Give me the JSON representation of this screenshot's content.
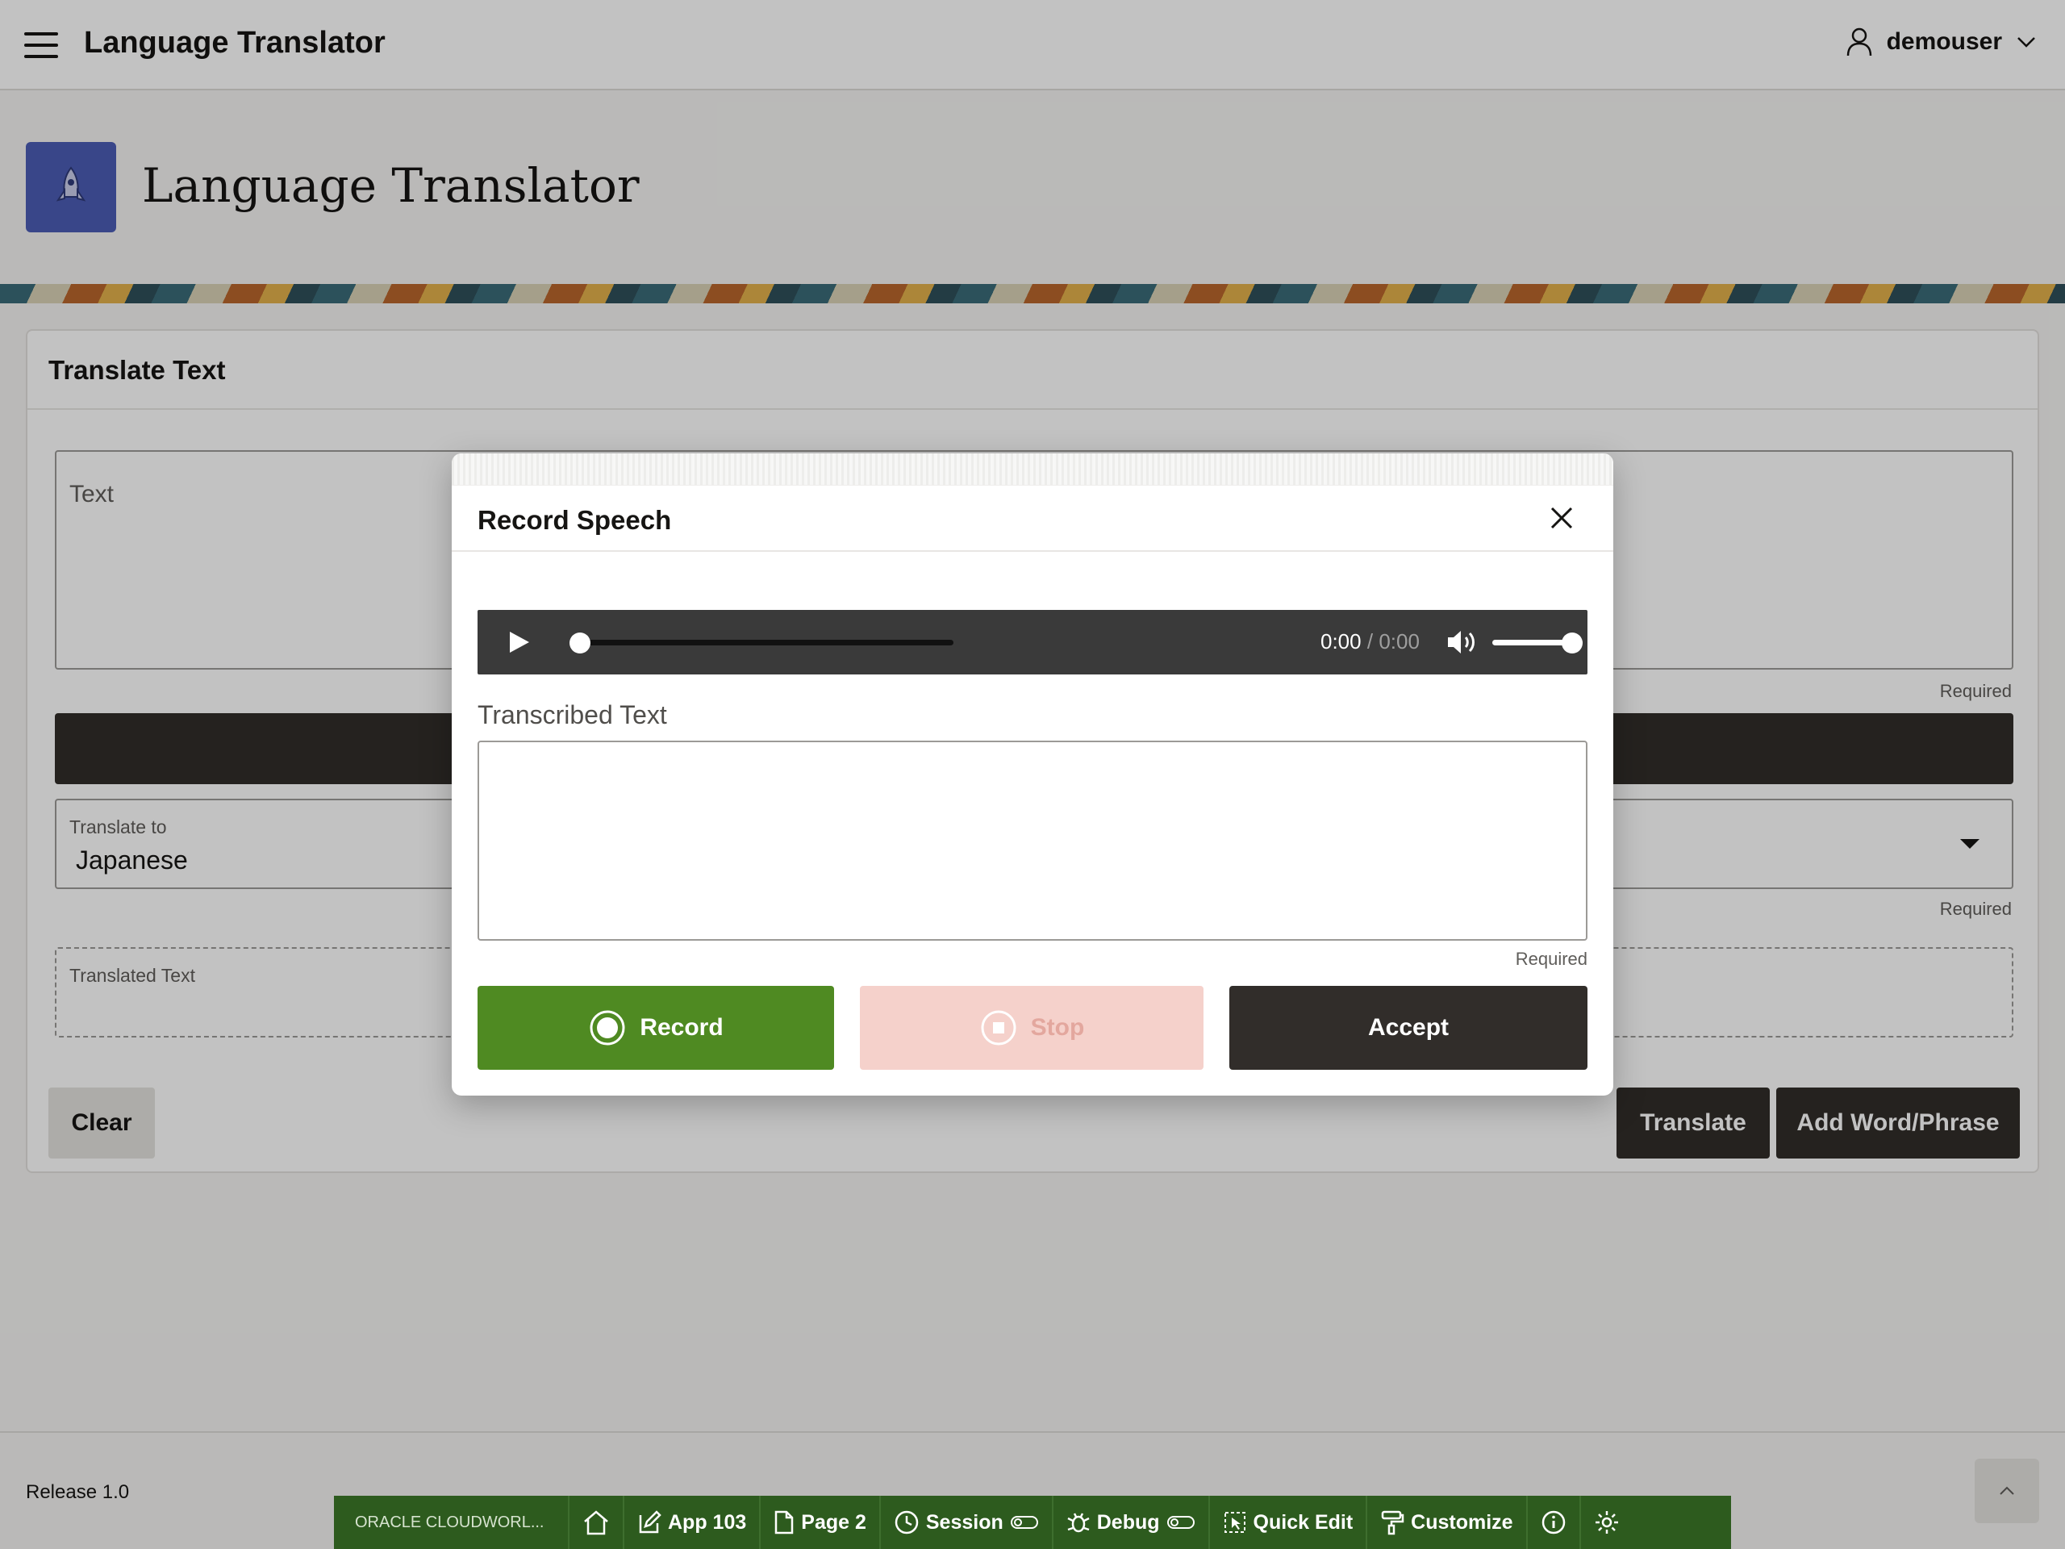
{
  "header": {
    "app_title": "Language Translator",
    "user": "demouser"
  },
  "hero": {
    "title": "Language Translator"
  },
  "region": {
    "title": "Translate Text",
    "text_label": "Text",
    "required": "Required",
    "translate_to_label": "Translate to",
    "translate_to_value": "Japanese",
    "translated_label": "Translated Text",
    "clear_label": "Clear",
    "translate_label": "Translate",
    "add_label": "Add Word/Phrase"
  },
  "footer": {
    "release": "Release 1.0"
  },
  "dialog": {
    "title": "Record Speech",
    "audio": {
      "current": "0:00",
      "separator": "/",
      "duration": "0:00",
      "progress": 0,
      "volume": 1.0
    },
    "transcribed_label": "Transcribed Text",
    "transcribed_value": "",
    "required": "Required",
    "record_label": "Record",
    "stop_label": "Stop",
    "accept_label": "Accept"
  },
  "devbar": {
    "brand": "ORACLE CLOUDWORL...",
    "app": "App 103",
    "page": "Page 2",
    "session": "Session",
    "debug": "Debug",
    "quick_edit": "Quick Edit",
    "customize": "Customize"
  },
  "colors": {
    "accent": "#4c5db5",
    "record": "#4f8a22",
    "stop": "#f5d1cb",
    "dark": "#312d2a",
    "devbar": "#2d5b1e"
  }
}
